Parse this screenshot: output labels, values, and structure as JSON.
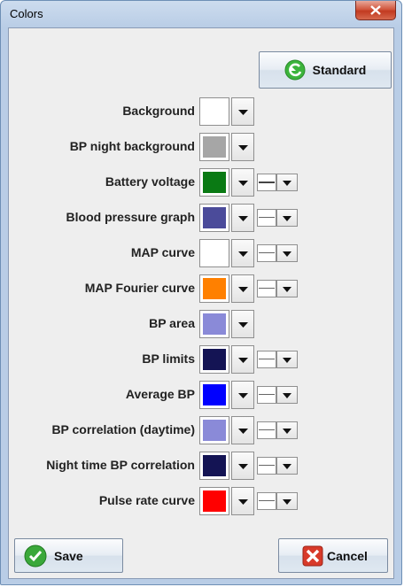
{
  "window": {
    "title": "Colors"
  },
  "buttons": {
    "standard": "Standard",
    "save": "Save",
    "cancel": "Cancel"
  },
  "rows": [
    {
      "label": "Background",
      "color": "#ffffff",
      "line_style": null
    },
    {
      "label": "BP night background",
      "color": "#a6a6a6",
      "line_style": null
    },
    {
      "label": "Battery voltage",
      "color": "#0a7a14",
      "line_style": "thick"
    },
    {
      "label": "Blood pressure graph",
      "color": "#4b4b9a",
      "line_style": "thin"
    },
    {
      "label": "MAP curve",
      "color": "#ffffff",
      "line_style": "thin"
    },
    {
      "label": "MAP Fourier curve",
      "color": "#ff8000",
      "line_style": "thin"
    },
    {
      "label": "BP area",
      "color": "#8a8ad8",
      "line_style": null
    },
    {
      "label": "BP limits",
      "color": "#141454",
      "line_style": "thin"
    },
    {
      "label": "Average BP",
      "color": "#0000ff",
      "line_style": "thin"
    },
    {
      "label": "BP correlation (daytime)",
      "color": "#8a8ad8",
      "line_style": "thin"
    },
    {
      "label": "Night time BP correlation",
      "color": "#141454",
      "line_style": "thin"
    },
    {
      "label": "Pulse rate curve",
      "color": "#ff0000",
      "line_style": "thin"
    }
  ]
}
